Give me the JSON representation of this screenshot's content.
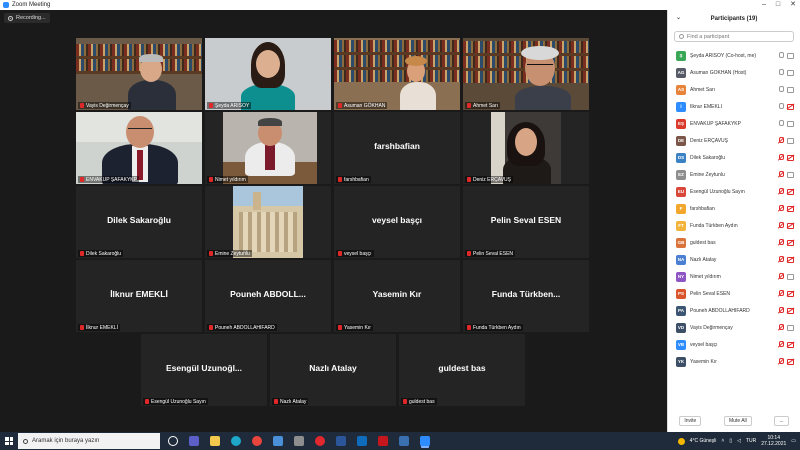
{
  "window": {
    "title": "Zoom Meeting",
    "controls": [
      "–",
      "□",
      "✕"
    ]
  },
  "meeting": {
    "recording_label": "Recording..."
  },
  "tiles": [
    {
      "name": "Vayis Değirmençay",
      "type": "video",
      "scene": "library-man"
    },
    {
      "name": "Şeyda ARISOY",
      "type": "video",
      "scene": "woman-gray"
    },
    {
      "name": "Asuman GÖKHAN",
      "type": "video",
      "scene": "library-woman"
    },
    {
      "name": "Ahmet Sarı",
      "type": "video",
      "scene": "library-man-glasses"
    },
    {
      "name": "ENVAKUP ŞAFAKYKP",
      "type": "video",
      "scene": "man-suit",
      "active": true
    },
    {
      "name": "Nimet yıldırım",
      "type": "video",
      "scene": "man-desk"
    },
    {
      "name": "farshbafian",
      "type": "name",
      "big": "farshbafian"
    },
    {
      "name": "Deniz ERÇAVUŞ",
      "type": "video",
      "scene": "woman-dark"
    },
    {
      "name": "Dilek Sakaroğlu",
      "type": "name",
      "big": "Dilek Sakaroğlu"
    },
    {
      "name": "Emine Zeytunlu",
      "type": "video",
      "scene": "building"
    },
    {
      "name": "veysel başçı",
      "type": "name",
      "big": "veysel başçı"
    },
    {
      "name": "Pelin Seval ESEN",
      "type": "name",
      "big": "Pelin Seval ESEN"
    },
    {
      "name": "İlknur EMEKLİ",
      "type": "name",
      "big": "İlknur EMEKLİ"
    },
    {
      "name": "Pouneh ABDOLLAHIFARD",
      "type": "name",
      "big": "Pouneh ABDOLL..."
    },
    {
      "name": "Yasemin Kır",
      "type": "name",
      "big": "Yasemin Kır"
    },
    {
      "name": "Funda Türkben Aydın",
      "type": "name",
      "big": "Funda Türkben..."
    },
    {
      "name": "Esengül Uzunoğlu Sayın",
      "type": "name",
      "big": "Esengül Uzunoğl..."
    },
    {
      "name": "Nazlı Atalay",
      "type": "name",
      "big": "Nazlı Atalay"
    },
    {
      "name": "guldest bas",
      "type": "name",
      "big": "guldest bas"
    }
  ],
  "panel": {
    "title": "Participants (19)",
    "search_placeholder": "Find a participant",
    "participants": [
      {
        "initials": "Ş",
        "name": "Şeyda ARISOY (Co-host, me)",
        "color": "#3aa757",
        "mic": "on",
        "cam": "on"
      },
      {
        "initials": "AG",
        "name": "Asuman GÖKHAN (Host)",
        "color": "#555a66",
        "mic": "on",
        "cam": "on"
      },
      {
        "initials": "AS",
        "name": "Ahmet Sarı",
        "color": "#e8833a",
        "mic": "on",
        "cam": "on"
      },
      {
        "initials": "İ",
        "name": "İlknur EMEKLİ",
        "color": "#2d8cff",
        "mic": "on",
        "cam": "off"
      },
      {
        "initials": "EŞ",
        "name": "ENVAKUP ŞAFAKYKP",
        "color": "#d93a2b",
        "mic": "on",
        "cam": "on"
      },
      {
        "initials": "DE",
        "name": "Deniz ERÇAVUŞ",
        "color": "#7a5548",
        "mic": "off",
        "cam": "on"
      },
      {
        "initials": "DS",
        "name": "Dilek Sakaroğlu",
        "color": "#3b82c4",
        "mic": "off",
        "cam": "off"
      },
      {
        "initials": "EZ",
        "name": "Emine Zeytunlu",
        "color": "#8d8d8d",
        "mic": "off",
        "cam": "on"
      },
      {
        "initials": "EU",
        "name": "Esengül Uzunoğlu Sayın",
        "color": "#d9473a",
        "mic": "off",
        "cam": "off"
      },
      {
        "initials": "F",
        "name": "farshbafian",
        "color": "#f2a72c",
        "mic": "off",
        "cam": "off"
      },
      {
        "initials": "FT",
        "name": "Funda Türkben Aydın",
        "color": "#f2b43a",
        "mic": "off",
        "cam": "off"
      },
      {
        "initials": "GB",
        "name": "guldest bas",
        "color": "#d9733a",
        "mic": "off",
        "cam": "off"
      },
      {
        "initials": "NA",
        "name": "Nazlı Atalay",
        "color": "#4a7fd1",
        "mic": "off",
        "cam": "off"
      },
      {
        "initials": "NY",
        "name": "Nimet yıldırım",
        "color": "#8e56c4",
        "mic": "off",
        "cam": "on"
      },
      {
        "initials": "PS",
        "name": "Pelin Seval ESEN",
        "color": "#d9552b",
        "mic": "off",
        "cam": "off"
      },
      {
        "initials": "PA",
        "name": "Pouneh ABDOLLAHIFARD",
        "color": "#3b5573",
        "mic": "off",
        "cam": "off"
      },
      {
        "initials": "VD",
        "name": "Vayis Değirmençay",
        "color": "#3c4f66",
        "mic": "off",
        "cam": "on"
      },
      {
        "initials": "VB",
        "name": "veysel başçı",
        "color": "#2d8cff",
        "mic": "off",
        "cam": "off"
      },
      {
        "initials": "YK",
        "name": "Yasemin Kır",
        "color": "#3c4f66",
        "mic": "off",
        "cam": "off"
      }
    ],
    "invite_label": "Invite",
    "mute_all_label": "Mute All",
    "more_label": "..."
  },
  "taskbar": {
    "search_placeholder": "Aramak için buraya yazın",
    "weather": "4°C  Güneşli",
    "language": "TUR",
    "time": "10:14",
    "date": "27.12.2021",
    "apps": [
      {
        "name": "task-view-icon",
        "color": "#1f2b3a"
      },
      {
        "name": "teams-icon",
        "color": "#5b5fc7"
      },
      {
        "name": "file-explorer-icon",
        "color": "#f2c94c"
      },
      {
        "name": "edge-icon",
        "color": "#1fa7c9"
      },
      {
        "name": "chrome-icon",
        "color": "#e8453c"
      },
      {
        "name": "control-panel-icon",
        "color": "#4a90d9"
      },
      {
        "name": "media-player-icon",
        "color": "#8e8e8e"
      },
      {
        "name": "opera-icon",
        "color": "#e0282e"
      },
      {
        "name": "word-icon",
        "color": "#2b579a"
      },
      {
        "name": "outlook-icon",
        "color": "#0f6cbd"
      },
      {
        "name": "pdf-reader-icon",
        "color": "#c4161c"
      },
      {
        "name": "paint-icon",
        "color": "#3a6fb0"
      },
      {
        "name": "zoom-icon",
        "color": "#2d8cff"
      }
    ]
  }
}
